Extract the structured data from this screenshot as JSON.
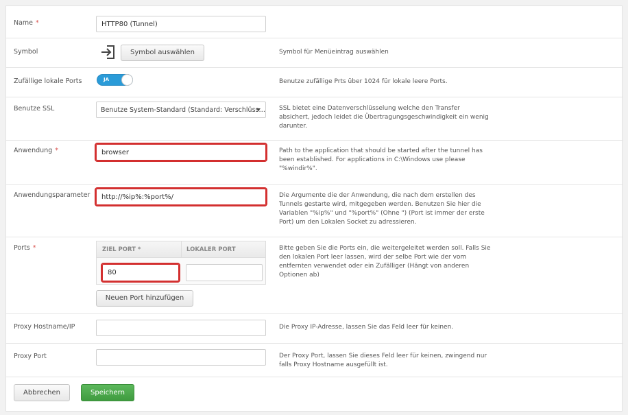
{
  "form": {
    "name": {
      "label": "Name",
      "required": "*",
      "value": "HTTP80 (Tunnel)"
    },
    "symbol": {
      "label": "Symbol",
      "button": "Symbol auswählen",
      "help": "Symbol für Menüeintrag auswählen",
      "icon": "sign-in-icon"
    },
    "random_ports": {
      "label": "Zufällige lokale Ports",
      "toggle_label": "JA",
      "help": "Benutze zufällige Prts über 1024 für lokale leere Ports."
    },
    "ssl": {
      "label": "Benutze SSL",
      "selected": "Benutze System-Standard (Standard: Verschlüss…",
      "help": "SSL bietet eine Datenverschlüsselung welche den Transfer absichert, jedoch leidet die Übertragungsgeschwindigkeit ein wenig darunter."
    },
    "application": {
      "label": "Anwendung",
      "required": "*",
      "value": "browser",
      "help": "Path to the application that should be started after the tunnel has been established. For applications in C:\\Windows use please \"%windir%\"."
    },
    "app_params": {
      "label": "Anwendungsparameter",
      "value": "http://%ip%:%port%/",
      "help": "Die Argumente die der Anwendung, die nach dem erstellen des Tunnels gestarte wird, mitgegeben werden. Benutzen Sie hier die Variablen \"%ip%\" und \"%port%\" (Ohne \") (Port ist immer der erste Port) um den Lokalen Socket zu adressieren."
    },
    "ports": {
      "label": "Ports",
      "required": "*",
      "col_target": "ZIEL PORT *",
      "col_local": "LOKALER PORT",
      "target_value": "80",
      "local_value": "",
      "add_button": "Neuen Port hinzufügen",
      "help": "Bitte geben Sie die Ports ein, die weitergeleitet werden soll. Falls Sie den lokalen Port leer lassen, wird der selbe Port wie der vom entfernten verwendet oder ein Zufälliger (Hängt von anderen Optionen ab)"
    },
    "proxy_host": {
      "label": "Proxy Hostname/IP",
      "value": "",
      "help": "Die Proxy IP-Adresse, lassen Sie das Feld leer für keinen."
    },
    "proxy_port": {
      "label": "Proxy Port",
      "value": "",
      "help": "Der Proxy Port, lassen Sie dieses Feld leer für keinen, zwingend nur falls Proxy Hostname ausgefüllt ist."
    }
  },
  "actions": {
    "cancel": "Abbrechen",
    "save": "Speichern"
  },
  "colors": {
    "accent": "#2a9bd8",
    "save": "#4cae4c",
    "highlight": "#d32f2f",
    "required": "#d9534f"
  }
}
